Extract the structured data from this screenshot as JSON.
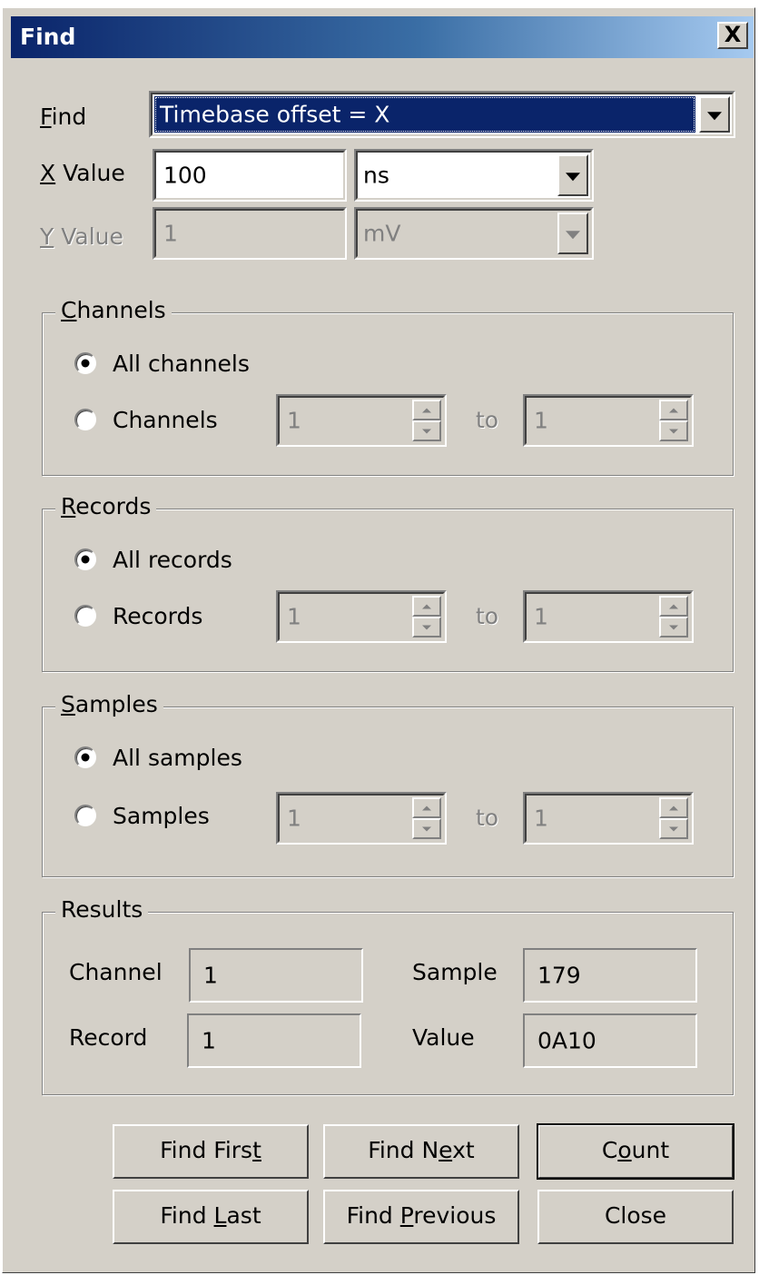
{
  "window": {
    "title": "Find",
    "close_glyph": "X"
  },
  "find": {
    "label": "Find",
    "label_ul": "F",
    "label_rest": "ind",
    "value": "Timebase offset = X"
  },
  "x_value": {
    "label_ul": "X",
    "label_rest": " Value",
    "value": "100",
    "unit": "ns"
  },
  "y_value": {
    "label_ul": "Y",
    "label_rest": " Value",
    "value": "1",
    "unit": "mV"
  },
  "channels": {
    "title_ul": "C",
    "title_rest": "hannels",
    "all_label": "All channels",
    "range_label": "Channels",
    "from": "1",
    "to_label": "to",
    "to": "1",
    "selected": "all"
  },
  "records": {
    "title_ul": "R",
    "title_rest": "ecords",
    "all_label": "All records",
    "range_label": "Records",
    "from": "1",
    "to_label": "to",
    "to": "1",
    "selected": "all"
  },
  "samples": {
    "title_ul": "S",
    "title_rest": "amples",
    "all_label": "All samples",
    "range_label": "Samples",
    "from": "1",
    "to_label": "to",
    "to": "1",
    "selected": "all"
  },
  "results": {
    "title": "Results",
    "channel_label": "Channel",
    "channel_value": "1",
    "sample_label": "Sample",
    "sample_value": "179",
    "record_label": "Record",
    "record_value": "1",
    "value_label": "Value",
    "value_value": "0A10"
  },
  "buttons": {
    "find_first_a": "Find Firs",
    "find_first_ul": "t",
    "find_first_b": "",
    "find_next_a": "Find N",
    "find_next_ul": "e",
    "find_next_b": "xt",
    "count_a": "C",
    "count_ul": "o",
    "count_b": "unt",
    "find_last_a": "Find ",
    "find_last_ul": "L",
    "find_last_b": "ast",
    "find_prev_a": "Find ",
    "find_prev_ul": "P",
    "find_prev_b": "revious",
    "close": "Close"
  }
}
